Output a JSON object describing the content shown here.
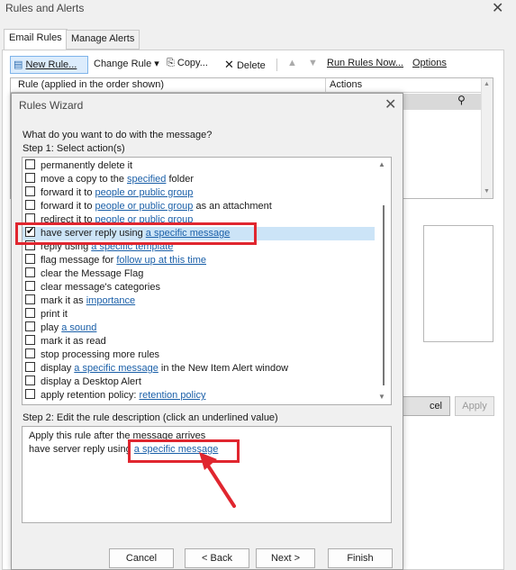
{
  "background_window": {
    "title": "Rules and Alerts",
    "tabs": [
      "Email Rules",
      "Manage Alerts"
    ],
    "toolbar": {
      "new_rule": "New Rule...",
      "change_rule": "Change Rule",
      "copy": "Copy...",
      "delete": "Delete",
      "run_rules_now": "Run Rules Now...",
      "options": "Options"
    },
    "rules_columns": [
      "Rule (applied in the order shown)",
      "Actions"
    ],
    "buttons": {
      "cancel_partial": "cel",
      "apply": "Apply"
    }
  },
  "wizard": {
    "title": "Rules Wizard",
    "question": "What do you want to do with the message?",
    "step1_label": "Step 1: Select action(s)",
    "actions": [
      {
        "pre": "permanently delete it",
        "link": "",
        "post": "",
        "checked": false
      },
      {
        "pre": "move a copy to the ",
        "link": "specified",
        "post": " folder",
        "checked": false
      },
      {
        "pre": "forward it to ",
        "link": "people or public group",
        "post": "",
        "checked": false
      },
      {
        "pre": "forward it to ",
        "link": "people or public group",
        "post": " as an attachment",
        "checked": false
      },
      {
        "pre": "redirect it to ",
        "link": "people or public group",
        "post": "",
        "checked": false
      },
      {
        "pre": "have server reply using ",
        "link": "a specific message",
        "post": "",
        "checked": true
      },
      {
        "pre": "reply using ",
        "link": "a specific template",
        "post": "",
        "checked": false
      },
      {
        "pre": "flag message for ",
        "link": "follow up at this time",
        "post": "",
        "checked": false
      },
      {
        "pre": "clear the Message Flag",
        "link": "",
        "post": "",
        "checked": false
      },
      {
        "pre": "clear message's categories",
        "link": "",
        "post": "",
        "checked": false
      },
      {
        "pre": "mark it as ",
        "link": "importance",
        "post": "",
        "checked": false
      },
      {
        "pre": "print it",
        "link": "",
        "post": "",
        "checked": false
      },
      {
        "pre": "play ",
        "link": "a sound",
        "post": "",
        "checked": false
      },
      {
        "pre": "mark it as read",
        "link": "",
        "post": "",
        "checked": false
      },
      {
        "pre": "stop processing more rules",
        "link": "",
        "post": "",
        "checked": false
      },
      {
        "pre": "display ",
        "link": "a specific message",
        "post": " in the New Item Alert window",
        "checked": false
      },
      {
        "pre": "display a Desktop Alert",
        "link": "",
        "post": "",
        "checked": false
      },
      {
        "pre": "apply retention policy: ",
        "link": "retention policy",
        "post": "",
        "checked": false
      }
    ],
    "step2_label": "Step 2: Edit the rule description (click an underlined value)",
    "description": {
      "line1": "Apply this rule after the message arrives",
      "line2_pre": "have server reply using ",
      "line2_link": "a specific message"
    },
    "buttons": {
      "cancel": "Cancel",
      "back": "< Back",
      "next": "Next >",
      "finish": "Finish"
    }
  },
  "colors": {
    "highlight_red": "#e0262f",
    "link_blue": "#1a5fa8",
    "selection": "#cce4f7"
  }
}
